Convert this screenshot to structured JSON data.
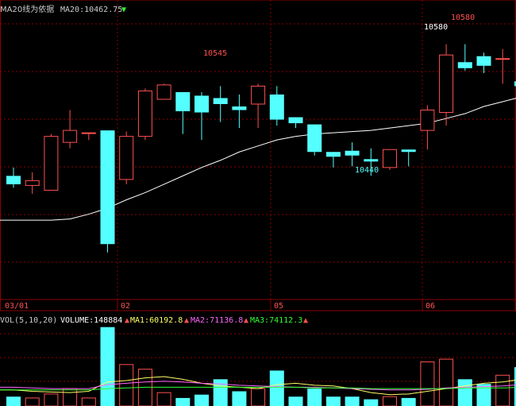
{
  "header": {
    "ma20_label": "MA20线为依据",
    "ma20_value": "MA20:10462.75",
    "ma20_arrow": "▼"
  },
  "price_panel": {
    "dates": [
      "03/01",
      "02",
      "05",
      "06"
    ],
    "annotations": [
      "10545",
      "10440",
      "10580",
      "10580"
    ]
  },
  "volume_panel": {
    "header": "VOL(5,10,20)",
    "volume_text": "VOLUME:148884",
    "ma1_text": "MA1:60192.8",
    "ma2_text": "MA2:71136.8",
    "ma3_text": "MA3:74112.3",
    "arrow": "▲"
  },
  "colors": {
    "up": "#ff5050",
    "down": "#54ffff",
    "grid": "#8b0000",
    "ma20": "#ffffff",
    "vol_ma1": "#ffff66",
    "vol_ma2": "#ff66ff",
    "vol_ma3": "#33ff33"
  },
  "chart_data": {
    "type": "candlestick",
    "price_ylim": [
      10370,
      10605
    ],
    "candles": [
      {
        "o": 10470,
        "h": 10477,
        "l": 10460,
        "c": 10463
      },
      {
        "o": 10462,
        "h": 10473,
        "l": 10455,
        "c": 10466
      },
      {
        "o": 10458,
        "h": 10505,
        "l": 10458,
        "c": 10503
      },
      {
        "o": 10498,
        "h": 10525,
        "l": 10493,
        "c": 10508
      },
      {
        "o": 10506,
        "h": 10506,
        "l": 10500,
        "c": 10506
      },
      {
        "o": 10508,
        "h": 10508,
        "l": 10406,
        "c": 10413
      },
      {
        "o": 10467,
        "h": 10507,
        "l": 10463,
        "c": 10503
      },
      {
        "o": 10503,
        "h": 10543,
        "l": 10500,
        "c": 10541
      },
      {
        "o": 10534,
        "h": 10547,
        "l": 10534,
        "c": 10546
      },
      {
        "o": 10540,
        "h": 10540,
        "l": 10505,
        "c": 10524
      },
      {
        "o": 10537,
        "h": 10540,
        "l": 10500,
        "c": 10523
      },
      {
        "o": 10535,
        "h": 10545,
        "l": 10515,
        "c": 10530
      },
      {
        "o": 10528,
        "h": 10538,
        "l": 10510,
        "c": 10525
      },
      {
        "o": 10530,
        "h": 10547,
        "l": 10510,
        "c": 10545
      },
      {
        "o": 10538,
        "h": 10545,
        "l": 10512,
        "c": 10517
      },
      {
        "o": 10519,
        "h": 10519,
        "l": 10510,
        "c": 10514
      },
      {
        "o": 10513,
        "h": 10513,
        "l": 10487,
        "c": 10490
      },
      {
        "o": 10490,
        "h": 10490,
        "l": 10477,
        "c": 10486
      },
      {
        "o": 10491,
        "h": 10498,
        "l": 10478,
        "c": 10487
      },
      {
        "o": 10484,
        "h": 10493,
        "l": 10470,
        "c": 10482
      },
      {
        "o": 10477,
        "h": 10492,
        "l": 10475,
        "c": 10492
      },
      {
        "o": 10492,
        "h": 10492,
        "l": 10478,
        "c": 10490
      },
      {
        "o": 10508,
        "h": 10529,
        "l": 10492,
        "c": 10525
      },
      {
        "o": 10523,
        "h": 10580,
        "l": 10512,
        "c": 10571
      },
      {
        "o": 10565,
        "h": 10580,
        "l": 10558,
        "c": 10560
      },
      {
        "o": 10570,
        "h": 10573,
        "l": 10556,
        "c": 10562
      },
      {
        "o": 10568,
        "h": 10576,
        "l": 10547,
        "c": 10568
      },
      {
        "o": 10549,
        "h": 10549,
        "l": 10535,
        "c": 10545
      }
    ],
    "ma20": [
      10433,
      10433,
      10433,
      10434,
      10438,
      10443,
      10450,
      10456,
      10463,
      10470,
      10477,
      10483,
      10490,
      10495,
      10500,
      10503,
      10505,
      10506,
      10507,
      10508,
      10510,
      10512,
      10514,
      10518,
      10522,
      10528,
      10532,
      10536
    ],
    "volume_ylim": [
      0,
      120000
    ],
    "volumes": [
      14000,
      12000,
      18000,
      26000,
      12000,
      118000,
      62000,
      55000,
      20000,
      12000,
      17000,
      40000,
      22000,
      26000,
      53000,
      14000,
      26000,
      14000,
      14000,
      10000,
      14000,
      12000,
      66000,
      70000,
      40000,
      33000,
      46000,
      58000
    ],
    "vol_ma1": [
      24000,
      22000,
      21000,
      20000,
      22000,
      36000,
      38000,
      42000,
      44000,
      40000,
      34000,
      30000,
      28000,
      26000,
      32000,
      34000,
      31000,
      30000,
      26000,
      20000,
      17000,
      18000,
      22000,
      26000,
      30000,
      34000,
      36000,
      40000
    ],
    "vol_ma2": [
      28000,
      27000,
      26000,
      26000,
      26000,
      32000,
      34000,
      36000,
      37000,
      36000,
      34000,
      33000,
      31000,
      30000,
      29000,
      28000,
      28000,
      27000,
      26000,
      25000,
      24000,
      24000,
      25000,
      27000,
      28000,
      29000,
      30000,
      32000
    ],
    "vol_ma3": [
      24000,
      24000,
      24000,
      24000,
      24000,
      26000,
      27000,
      28000,
      28000,
      28000,
      28000,
      28000,
      28000,
      28000,
      28000,
      28000,
      27000,
      27000,
      27000,
      26000,
      26000,
      26000,
      26000,
      26000,
      27000,
      27000,
      27000,
      28000
    ]
  }
}
